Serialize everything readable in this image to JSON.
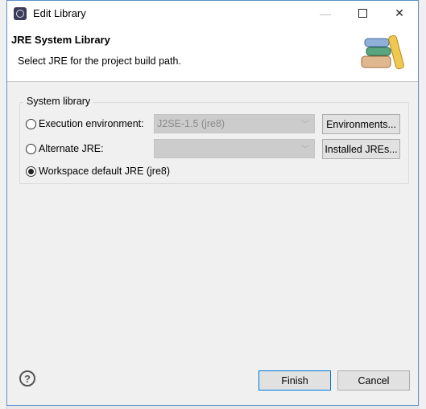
{
  "window": {
    "title": "Edit Library",
    "minimize_icon": "minimize-icon",
    "maximize_icon": "maximize-icon",
    "close_icon": "close-icon"
  },
  "header": {
    "title": "JRE System Library",
    "description": "Select JRE for the project build path."
  },
  "group": {
    "label": "System library",
    "execution_env": {
      "label": "Execution environment:",
      "value": "J2SE-1.5 (jre8)",
      "button": "Environments...",
      "selected": false
    },
    "alternate_jre": {
      "label": "Alternate JRE:",
      "value": "",
      "button": "Installed JREs...",
      "selected": false
    },
    "workspace_default": {
      "label": "Workspace default JRE (jre8)",
      "selected": true
    }
  },
  "footer": {
    "help": "?",
    "finish": "Finish",
    "cancel": "Cancel"
  },
  "colors": {
    "accent": "#0078d7",
    "window_border": "#5b8fc7"
  }
}
